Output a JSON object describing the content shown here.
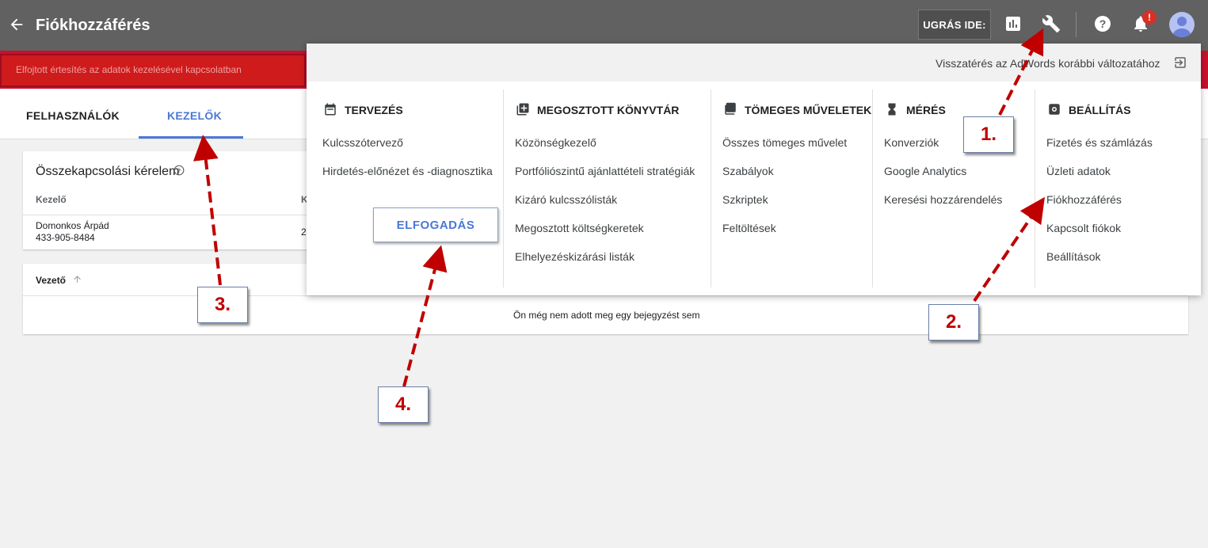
{
  "header": {
    "title": "Fiókhozzáférés",
    "goto_label": "UGRÁS IDE:",
    "notification_badge": "!"
  },
  "banner": {
    "text": "Elfojtott értesítés az adatok kezelésével kapcsolatban"
  },
  "tabs": [
    {
      "label": "FELHASZNÁLÓK"
    },
    {
      "label": "KEZELŐK"
    }
  ],
  "link_requests": {
    "title": "Összekapcsolási kérelem",
    "columns": [
      "Kezelő",
      "K"
    ],
    "rows": [
      {
        "name": "Domonkos Árpád",
        "id": "433-905-8484",
        "second": "2"
      }
    ]
  },
  "managers_table": {
    "column": "Vezető",
    "empty_text": "Ön még nem adott meg egy bejegyzést sem"
  },
  "menu": {
    "back_old": "Visszatérés az AdWords korábbi változatához",
    "sections": [
      {
        "title": "TERVEZÉS",
        "items": [
          "Kulcsszótervező",
          "Hirdetés-előnézet és -diagnosztika"
        ]
      },
      {
        "title": "MEGOSZTOTT KÖNYVTÁR",
        "items": [
          "Közönségkezelő",
          "Portfólió­szintű ajánlattételi stratégiák",
          "Kizáró kulcsszólisták",
          "Megosztott költségkeretek",
          "Elhelyezéskizárási listák"
        ]
      },
      {
        "title": "TÖMEGES MŰVELETEK",
        "items": [
          "Összes tömeges művelet",
          "Szabályok",
          "Szkriptek",
          "Feltöltések"
        ]
      },
      {
        "title": "MÉRÉS",
        "items": [
          "Konverziók",
          "Google Analytics",
          "Keresési hozzárendelés"
        ]
      },
      {
        "title": "BEÁLLÍTÁS",
        "items": [
          "Fizetés és számlázás",
          "Üzleti adatok",
          "Fiókhozzáférés",
          "Kapcsolt fiókok",
          "Beállítások"
        ]
      }
    ]
  },
  "accept_button": "ELFOGADÁS",
  "annotations": [
    "1.",
    "2.",
    "3.",
    "4."
  ],
  "colors": {
    "accent": "#4a78d6",
    "topbar": "#616161",
    "annotation": "#c00000"
  }
}
